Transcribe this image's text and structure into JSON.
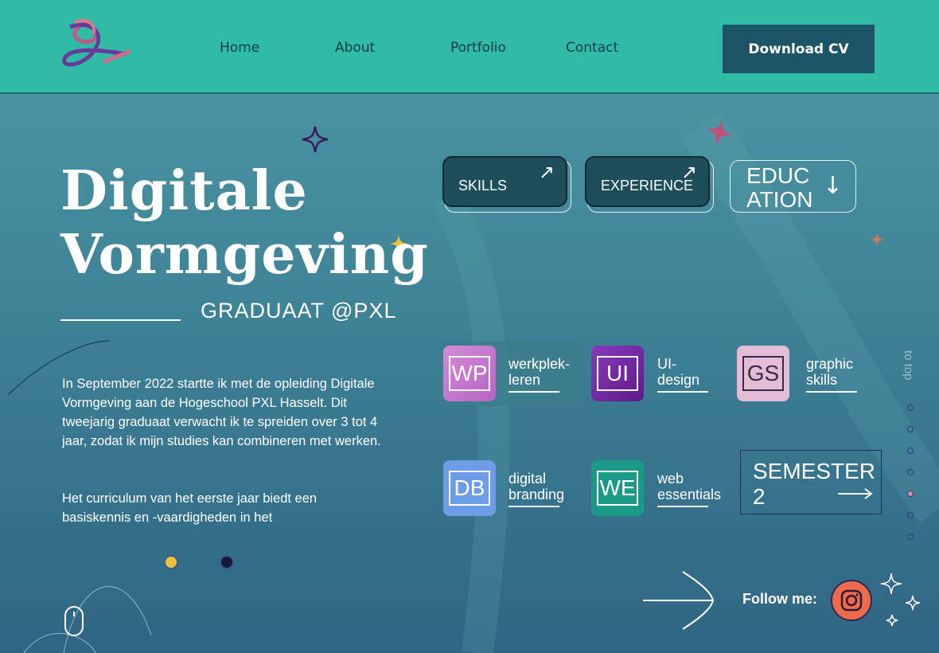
{
  "nav": {
    "home": "Home",
    "about": "About",
    "portfolio": "Portfolio",
    "contact": "Contact",
    "download": "Download CV"
  },
  "hero": {
    "title_line1": "Digitale",
    "title_line2": "Vormgeving",
    "subtitle": "GRADUAAT @PXL",
    "para1": "In September 2022 startte ik met de opleiding Digitale Vormgeving aan de Hogeschool PXL Hasselt. Dit tweejarig graduaat verwacht ik te spreiden over 3 tot 4 jaar, zodat ik mijn studies kan combineren met werken.",
    "para2": "Het curriculum van het eerste jaar biedt een basiskennis en -vaardigheden in het"
  },
  "tabs": {
    "skills": "SKILLS",
    "experience": "EXPERIENCE",
    "education_line1": "EDUC",
    "education_line2": "ATION"
  },
  "courses": [
    {
      "abbr": "WP",
      "line1": "werkplek-",
      "line2": "leren",
      "color": "#c27ad0"
    },
    {
      "abbr": "UI",
      "line1": "UI-",
      "line2": "design",
      "color": "#7a2aa3"
    },
    {
      "abbr": "GS",
      "line1": "graphic",
      "line2": "skills",
      "color": "#e2b8d3"
    },
    {
      "abbr": "DB",
      "line1": "digital",
      "line2": "branding",
      "color": "#6e9de8"
    },
    {
      "abbr": "WE",
      "line1": "web",
      "line2": "essentials",
      "color": "#1a9a88"
    }
  ],
  "semester": {
    "line1": "SEMESTER",
    "line2": "2"
  },
  "side": {
    "to_top": "to top"
  },
  "footer": {
    "follow": "Follow me:"
  },
  "colors": {
    "header": "#2fbba5",
    "button": "#1c5566",
    "accent_pink": "#e08aa0",
    "accent_yellow": "#f0c23a"
  },
  "icons": [
    "logo-icon",
    "arrow-up-right-icon",
    "arrow-down-icon",
    "arrow-right-icon",
    "sparkle-icon",
    "instagram-icon",
    "mouse-icon"
  ]
}
